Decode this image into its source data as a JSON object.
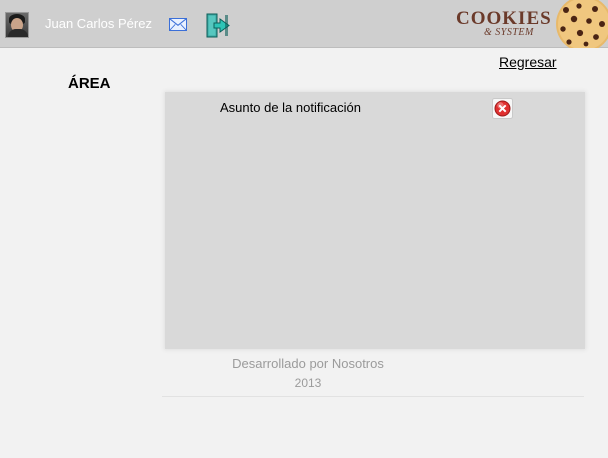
{
  "header": {
    "user_name": "Juan Carlos Pérez",
    "icons": {
      "avatar": "user-avatar",
      "mail": "mail-icon",
      "logout": "logout-icon"
    },
    "logo": {
      "line1": "COOKIES",
      "line2": "& SYSTEM"
    }
  },
  "nav": {
    "back_label": "Regresar"
  },
  "main": {
    "section_title": "ÁREA",
    "notification": {
      "subject": "Asunto de la notificación"
    }
  },
  "footer": {
    "credit": "Desarrollado por Nosotros",
    "year": "2013"
  },
  "colors": {
    "header_bg": "#cfcfcf",
    "page_bg": "#f2f2f2",
    "panel_bg": "#d9d9d9",
    "footer_text": "#9b9b9b",
    "close_red": "#e03030"
  }
}
